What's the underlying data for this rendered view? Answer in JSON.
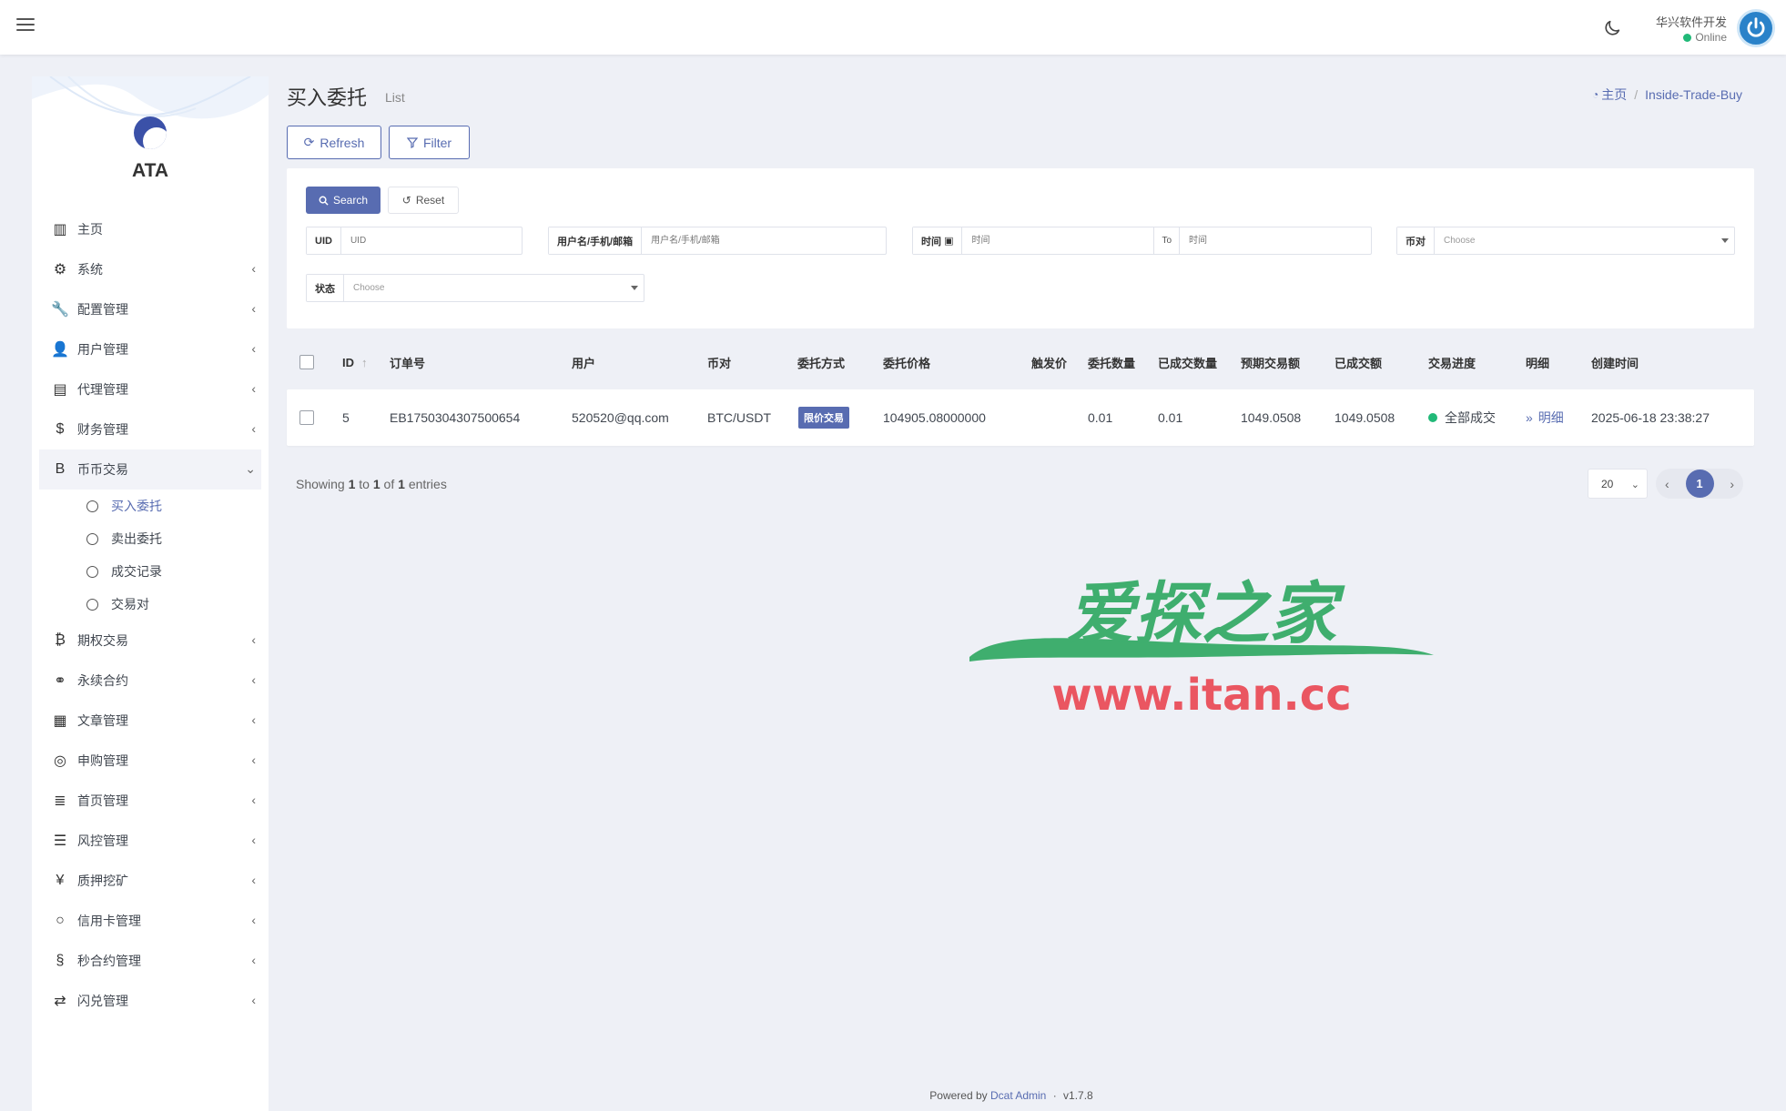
{
  "navbar": {
    "user_name": "华兴软件开发",
    "user_status": "Online"
  },
  "sidebar": {
    "logo_text": "ATA",
    "items": [
      {
        "label": "主页",
        "icon": "bar-chart-icon",
        "glyph": "▥",
        "chevron": false
      },
      {
        "label": "系统",
        "icon": "gear-icon",
        "glyph": "⚙",
        "chevron": true
      },
      {
        "label": "配置管理",
        "icon": "wrench-icon",
        "glyph": "🔧",
        "chevron": true
      },
      {
        "label": "用户管理",
        "icon": "user-icon",
        "glyph": "👤",
        "chevron": true
      },
      {
        "label": "代理管理",
        "icon": "id-card-icon",
        "glyph": "▤",
        "chevron": true
      },
      {
        "label": "财务管理",
        "icon": "dollar-icon",
        "glyph": "$",
        "chevron": true
      },
      {
        "label": "币币交易",
        "icon": "bitcoin-b-icon",
        "glyph": "B",
        "chevron": true,
        "expanded": true
      }
    ],
    "sub_items": [
      {
        "label": "买入委托",
        "active": true
      },
      {
        "label": "卖出委托"
      },
      {
        "label": "成交记录"
      },
      {
        "label": "交易对"
      }
    ],
    "items_after": [
      {
        "label": "期权交易",
        "icon": "bitcoin-icon",
        "glyph": "₿"
      },
      {
        "label": "永续合约",
        "icon": "link-icon",
        "glyph": "⚭"
      },
      {
        "label": "文章管理",
        "icon": "newspaper-icon",
        "glyph": "▦"
      },
      {
        "label": "申购管理",
        "icon": "lifebuoy-icon",
        "glyph": "◎"
      },
      {
        "label": "首页管理",
        "icon": "list-icon",
        "glyph": "≣"
      },
      {
        "label": "风控管理",
        "icon": "indent-icon",
        "glyph": "☰"
      },
      {
        "label": "质押挖矿",
        "icon": "yen-icon",
        "glyph": "¥"
      },
      {
        "label": "信用卡管理",
        "icon": "circle-icon",
        "glyph": "○"
      },
      {
        "label": "秒合约管理",
        "icon": "fingerprint-icon",
        "glyph": "§"
      },
      {
        "label": "闪兑管理",
        "icon": "exchange-icon",
        "glyph": "⇄"
      }
    ]
  },
  "header": {
    "title": "买入委托",
    "subtitle": "List",
    "breadcrumb_home": "主页",
    "breadcrumb_current": "Inside-Trade-Buy"
  },
  "toolbar": {
    "refresh_label": "Refresh",
    "filter_label": "Filter"
  },
  "filter": {
    "search_label": "Search",
    "reset_label": "Reset",
    "uid_label": "UID",
    "uid_placeholder": "UID",
    "user_label": "用户名/手机/邮箱",
    "user_placeholder": "用户名/手机/邮箱",
    "time_label": "时间",
    "time_placeholder_start": "时间",
    "to_label": "To",
    "time_placeholder_end": "时间",
    "pair_label": "币对",
    "pair_value": "Choose",
    "status_label": "状态",
    "status_value": "Choose"
  },
  "table": {
    "columns": [
      "ID",
      "订单号",
      "用户",
      "币对",
      "委托方式",
      "委托价格",
      "触发价",
      "委托数量",
      "已成交数量",
      "预期交易额",
      "已成交额",
      "交易进度",
      "明细",
      "创建时间"
    ],
    "rows": [
      {
        "id": "5",
        "order_no": "EB1750304307500654",
        "user": "520520@qq.com",
        "pair": "BTC/USDT",
        "type": "限价交易",
        "price": "104905.08000000",
        "trigger": "",
        "qty": "0.01",
        "filled_qty": "0.01",
        "expected_amount": "1049.0508",
        "filled_amount": "1049.0508",
        "progress": "全部成交",
        "detail": "明细",
        "created_at": "2025-06-18 23:38:27"
      }
    ]
  },
  "pagination": {
    "showing_prefix": "Showing",
    "from": "1",
    "to_word": "to",
    "to": "1",
    "of_word": "of",
    "total": "1",
    "entries_word": "entries",
    "page_size": "20",
    "current_page": "1"
  },
  "watermark": {
    "cn": "爱探之家",
    "url": "www.itan.cc"
  },
  "footer": {
    "powered_by": "Powered by",
    "brand": "Dcat Admin",
    "dot": "·",
    "version": "v1.7.8"
  },
  "colors": {
    "primary": "#586cb1",
    "success": "#21b978",
    "background": "#eef0f6"
  }
}
